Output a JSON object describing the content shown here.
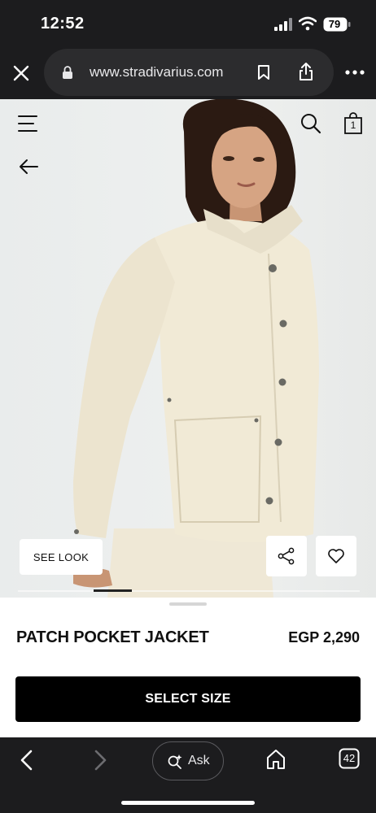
{
  "status_bar": {
    "time": "12:52",
    "battery": "79"
  },
  "browser": {
    "url": "www.stradivarius.com",
    "ask_label": "Ask",
    "tab_count": "42"
  },
  "header": {
    "bag_count": "1"
  },
  "product": {
    "see_look_label": "SEE LOOK",
    "name": "PATCH POCKET JACKET",
    "price": "EGP 2,290",
    "select_size_label": "SELECT SIZE"
  },
  "icons": {
    "close": "close-icon",
    "lock": "lock-icon",
    "bookmark": "bookmark-icon",
    "share": "share-icon",
    "more": "more-icon",
    "menu": "menu-icon",
    "back": "back-arrow-icon",
    "search": "search-icon",
    "bag": "shopping-bag-icon",
    "share_product": "share-nodes-icon",
    "wishlist": "heart-icon",
    "nav_back": "chevron-left-icon",
    "nav_forward": "chevron-right-icon",
    "ask": "sparkle-search-icon",
    "home": "home-icon",
    "tabs": "tabs-icon"
  },
  "colors": {
    "chrome": "#1c1c1e",
    "url_pill": "#2c2c2e",
    "button": "#000000",
    "sheet": "#ffffff"
  }
}
